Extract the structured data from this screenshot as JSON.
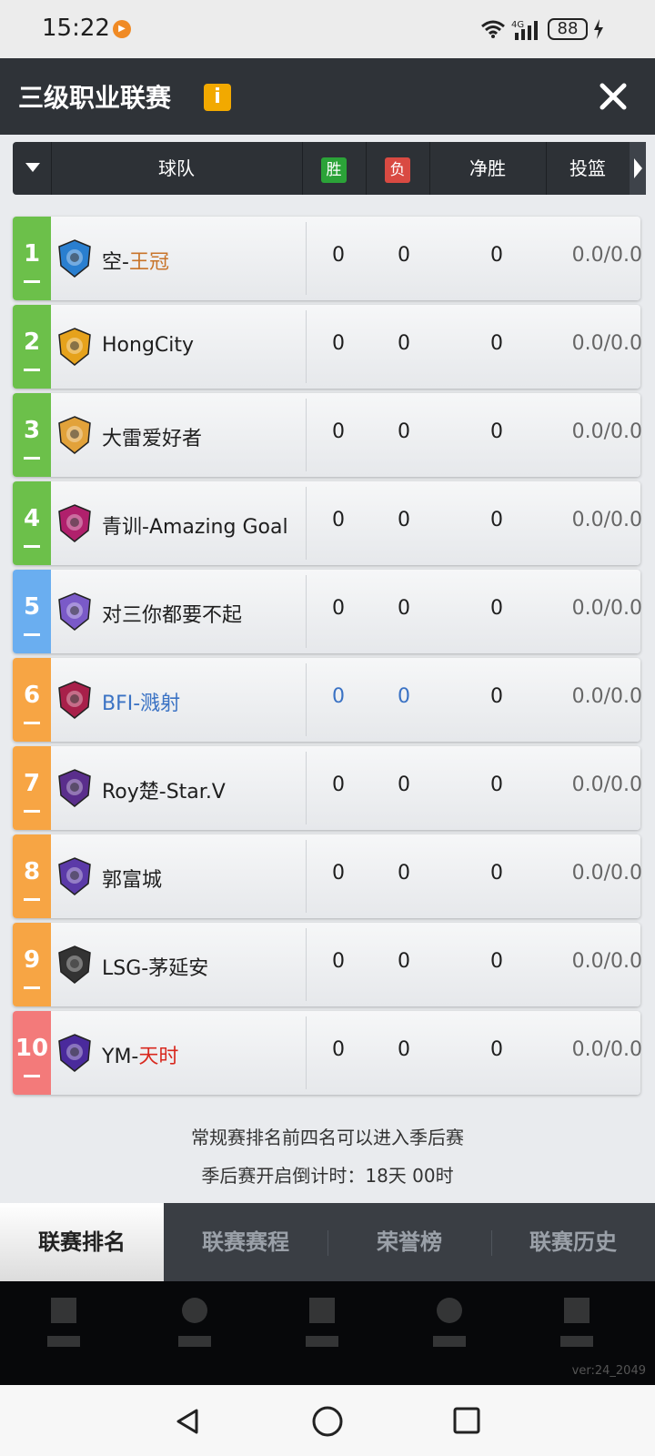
{
  "status_bar": {
    "time": "15:22",
    "network": "4G",
    "battery": "88"
  },
  "header": {
    "title": "三级职业联赛",
    "info_label": "i"
  },
  "table_header": {
    "team": "球队",
    "wins": "胜",
    "losses": "负",
    "net": "净胜",
    "shooting": "投篮"
  },
  "teams": [
    {
      "rank": "1",
      "name_prefix": "空-",
      "name_suffix": "王冠",
      "suffix_color": "#c8742a",
      "name_color": "#1e1e1e",
      "wins": "0",
      "losses": "0",
      "net": "0",
      "shooting": "0.0/0.0",
      "rank_color": "#6cc04a",
      "stat_color": "#1e1e1e"
    },
    {
      "rank": "2",
      "name_prefix": "HongCity",
      "name_suffix": "",
      "suffix_color": "#1e1e1e",
      "name_color": "#1e1e1e",
      "wins": "0",
      "losses": "0",
      "net": "0",
      "shooting": "0.0/0.0",
      "rank_color": "#6cc04a",
      "stat_color": "#1e1e1e"
    },
    {
      "rank": "3",
      "name_prefix": "大雷爱好者",
      "name_suffix": "",
      "suffix_color": "#1e1e1e",
      "name_color": "#1e1e1e",
      "wins": "0",
      "losses": "0",
      "net": "0",
      "shooting": "0.0/0.0",
      "rank_color": "#6cc04a",
      "stat_color": "#1e1e1e"
    },
    {
      "rank": "4",
      "name_prefix": "青训-Amazing Goal",
      "name_suffix": "",
      "suffix_color": "#1e1e1e",
      "name_color": "#1e1e1e",
      "wins": "0",
      "losses": "0",
      "net": "0",
      "shooting": "0.0/0.0",
      "rank_color": "#6cc04a",
      "stat_color": "#1e1e1e"
    },
    {
      "rank": "5",
      "name_prefix": "对三你都要不起",
      "name_suffix": "",
      "suffix_color": "#1e1e1e",
      "name_color": "#1e1e1e",
      "wins": "0",
      "losses": "0",
      "net": "0",
      "shooting": "0.0/0.0",
      "rank_color": "#6aaef0",
      "stat_color": "#1e1e1e"
    },
    {
      "rank": "6",
      "name_prefix": "BFI-溅射",
      "name_suffix": "",
      "suffix_color": "#3a72c4",
      "name_color": "#3a72c4",
      "wins": "0",
      "losses": "0",
      "net": "0",
      "shooting": "0.0/0.0",
      "rank_color": "#f7a544",
      "stat_color": "#3a72c4"
    },
    {
      "rank": "7",
      "name_prefix": "Roy楚-Star.V",
      "name_suffix": "",
      "suffix_color": "#1e1e1e",
      "name_color": "#1e1e1e",
      "wins": "0",
      "losses": "0",
      "net": "0",
      "shooting": "0.0/0.0",
      "rank_color": "#f7a544",
      "stat_color": "#1e1e1e"
    },
    {
      "rank": "8",
      "name_prefix": "郭富城",
      "name_suffix": "",
      "suffix_color": "#1e1e1e",
      "name_color": "#1e1e1e",
      "wins": "0",
      "losses": "0",
      "net": "0",
      "shooting": "0.0/0.0",
      "rank_color": "#f7a544",
      "stat_color": "#1e1e1e"
    },
    {
      "rank": "9",
      "name_prefix": "LSG-茅延安",
      "name_suffix": "",
      "suffix_color": "#1e1e1e",
      "name_color": "#1e1e1e",
      "wins": "0",
      "losses": "0",
      "net": "0",
      "shooting": "0.0/0.0",
      "rank_color": "#f7a544",
      "stat_color": "#1e1e1e"
    },
    {
      "rank": "10",
      "name_prefix": "YM-",
      "name_suffix": "天时",
      "suffix_color": "#d8281e",
      "name_color": "#1e1e1e",
      "wins": "0",
      "losses": "0",
      "net": "0",
      "shooting": "0.0/0.0",
      "rank_color": "#f37a7a",
      "stat_color": "#1e1e1e"
    }
  ],
  "notes": {
    "playoff_rule": "常规赛排名前四名可以进入季后赛",
    "countdown": "季后赛开启倒计时：18天 00时"
  },
  "tabs": [
    {
      "label": "联赛排名",
      "active": true
    },
    {
      "label": "联赛赛程",
      "active": false
    },
    {
      "label": "荣誉榜",
      "active": false
    },
    {
      "label": "联赛历史",
      "active": false
    }
  ],
  "footer": {
    "version": "ver:24_2049"
  },
  "icons": {
    "status_app": "app-notification-icon",
    "wifi": "wifi-icon",
    "signal": "signal-icon",
    "charge": "charging-icon",
    "info": "info-icon",
    "close": "close-icon",
    "sort": "dropdown-sort-icon",
    "scroll": "scroll-right-icon",
    "nav_back": "nav-back-icon",
    "nav_home": "nav-home-icon",
    "nav_recent": "nav-recent-icon"
  },
  "colors": {
    "title_bar": "#2f3338",
    "win_badge": "#2ba338",
    "loss_badge": "#d94a42",
    "info_badge": "#f2a900"
  }
}
